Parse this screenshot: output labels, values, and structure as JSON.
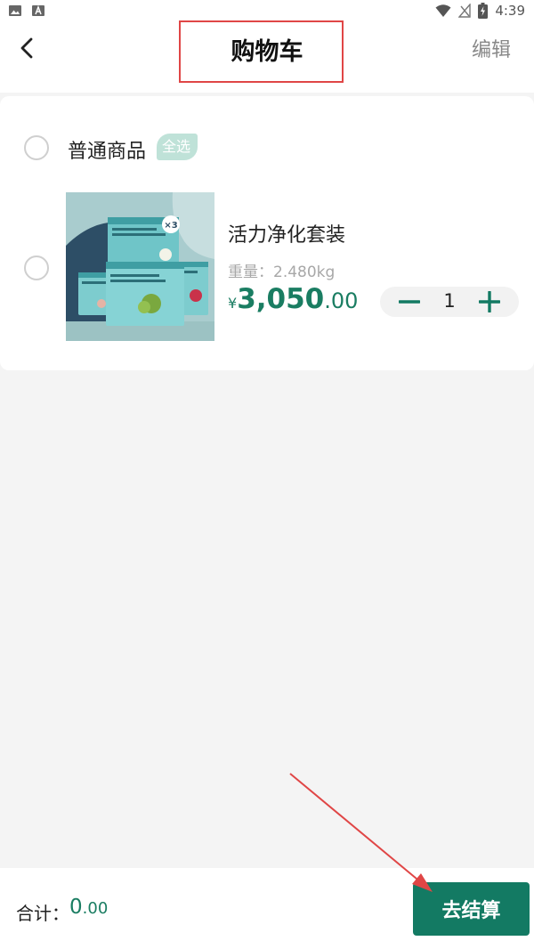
{
  "status_bar": {
    "time": "4:39"
  },
  "header": {
    "title": "购物车",
    "edit_label": "编辑"
  },
  "cart": {
    "group": {
      "label": "普通商品",
      "select_all_label": "全选"
    },
    "items": [
      {
        "name": "活力净化套装",
        "weight": "重量：2.480kg",
        "currency": "¥",
        "price_int": "3,050",
        "price_dec": ".00",
        "quantity": "1",
        "image_badge": "×3"
      }
    ]
  },
  "footer": {
    "total_label": "合计：",
    "total_int": "0",
    "total_dec": ".00",
    "checkout_label": "去结算"
  },
  "colors": {
    "accent": "#137a63",
    "price": "#1a7d62",
    "annotation": "#e04646"
  }
}
